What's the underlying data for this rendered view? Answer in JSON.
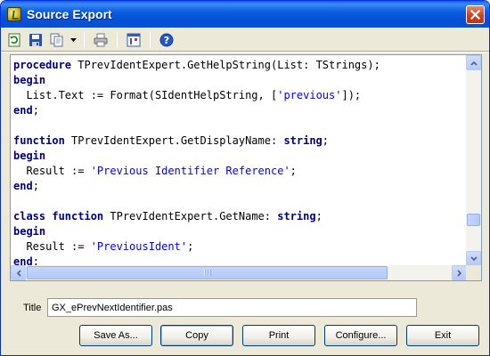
{
  "window": {
    "title": "Source Export",
    "app_icon": "gexperts-icon",
    "close_icon": "close-icon"
  },
  "toolbar": {
    "items": [
      {
        "name": "refresh-icon",
        "label": ""
      },
      {
        "name": "save-icon",
        "label": ""
      },
      {
        "name": "copy-icon",
        "label": ""
      },
      {
        "name": "print-icon",
        "label": ""
      },
      {
        "name": "configure-icon",
        "label": ""
      },
      {
        "name": "help-icon",
        "label": ""
      }
    ]
  },
  "editor": {
    "lines": [
      [
        {
          "t": "procedure",
          "k": "kw"
        },
        {
          "t": " TPrevIdentExpert.GetHelpString(List: TStrings);",
          "k": ""
        }
      ],
      [
        {
          "t": "begin",
          "k": "kw"
        }
      ],
      [
        {
          "t": "  List.Text := Format(SIdentHelpString, [",
          "k": ""
        },
        {
          "t": "'previous'",
          "k": "str"
        },
        {
          "t": "]);",
          "k": ""
        }
      ],
      [
        {
          "t": "end",
          "k": "kw"
        },
        {
          "t": ";",
          "k": ""
        }
      ],
      [],
      [
        {
          "t": "function",
          "k": "kw"
        },
        {
          "t": " TPrevIdentExpert.GetDisplayName: ",
          "k": ""
        },
        {
          "t": "string",
          "k": "kw"
        },
        {
          "t": ";",
          "k": ""
        }
      ],
      [
        {
          "t": "begin",
          "k": "kw"
        }
      ],
      [
        {
          "t": "  Result := ",
          "k": ""
        },
        {
          "t": "'Previous Identifier Reference'",
          "k": "str"
        },
        {
          "t": ";",
          "k": ""
        }
      ],
      [
        {
          "t": "end",
          "k": "kw"
        },
        {
          "t": ";",
          "k": ""
        }
      ],
      [],
      [
        {
          "t": "class function",
          "k": "kw"
        },
        {
          "t": " TPrevIdentExpert.GetName: ",
          "k": ""
        },
        {
          "t": "string",
          "k": "kw"
        },
        {
          "t": ";",
          "k": ""
        }
      ],
      [
        {
          "t": "begin",
          "k": "kw"
        }
      ],
      [
        {
          "t": "  Result := ",
          "k": ""
        },
        {
          "t": "'PreviousIdent'",
          "k": "str"
        },
        {
          "t": ";",
          "k": ""
        }
      ],
      [
        {
          "t": "end",
          "k": "kw"
        },
        {
          "t": ";",
          "k": ""
        }
      ]
    ],
    "colors": {
      "keyword": "#000080",
      "string": "#0000ff",
      "text": "#000000"
    }
  },
  "title_field": {
    "label": "Title",
    "value": "GX_ePrevNextIdentifier.pas"
  },
  "buttons": {
    "save_as": "Save As...",
    "copy": "Copy",
    "print": "Print",
    "configure": "Configure...",
    "exit": "Exit"
  }
}
